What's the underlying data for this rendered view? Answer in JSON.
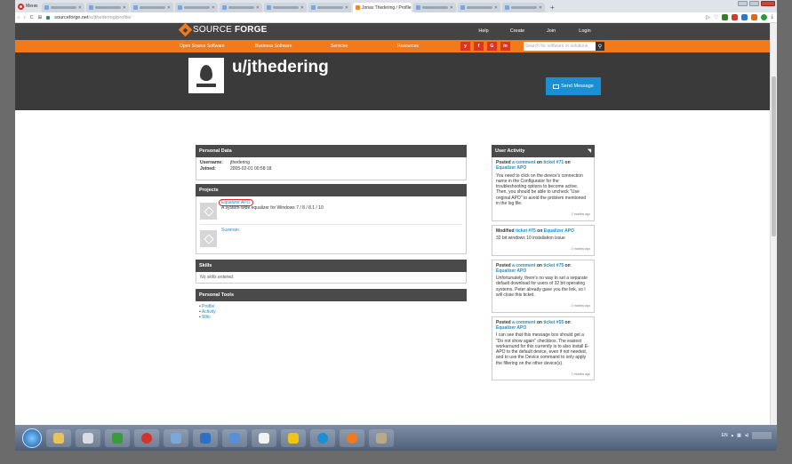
{
  "browser": {
    "opera_label": "Меню",
    "active_tab": "Jonas Thedering / Profile",
    "url_host": "sourceforge.net",
    "url_path": "/u/jthedering/profile/"
  },
  "site": {
    "logo_source": "SOURCE",
    "logo_forge": "FORGE",
    "top_nav": [
      "Help",
      "Create",
      "Join",
      "Login"
    ],
    "main_nav": [
      "Open Source Software",
      "Business Software",
      "Services",
      "Resources"
    ],
    "social": [
      "y",
      "f",
      "G",
      "in"
    ],
    "search_placeholder": "Search for software or solutions"
  },
  "profile": {
    "username": "u/jthedering",
    "send_message": "Send Message"
  },
  "personal_data": {
    "title": "Personal Data",
    "username_label": "Username:",
    "username_value": "jthedering",
    "joined_label": "Joined:",
    "joined_value": "2005-02-01 00:58:18"
  },
  "projects": {
    "title": "Projects",
    "items": [
      {
        "name": "Equalizer APO",
        "desc": "A system-wide equalizer for Windows 7 / 8 / 8.1 / 10"
      },
      {
        "name": "Suzerain",
        "desc": ""
      }
    ]
  },
  "skills": {
    "title": "Skills",
    "empty": "No skills entered."
  },
  "tools": {
    "title": "Personal Tools",
    "items": [
      "Profile",
      "Activity",
      "Wiki"
    ]
  },
  "activity": {
    "title": "User Activity",
    "entries": [
      {
        "pre": "Posted ",
        "link1": "a comment",
        "mid": " on ",
        "link2": "ticket #71",
        "on": " on ",
        "link3": "Equalizer APO",
        "body": "You need to click on the device's connection name in the Configurator for the troubleshooting options to become active. Then, you should be able to uncheck \"Use original APO\" to avoid the problem mentioned in the log file.",
        "ago": "2 months ago"
      },
      {
        "pre": "Modified ",
        "link1": "",
        "mid": "",
        "link2": "ticket #75",
        "on": " on ",
        "link3": "Equalizer APO",
        "body": "32 bit windows 10 installation issue",
        "ago": "2 months ago"
      },
      {
        "pre": "Posted ",
        "link1": "a comment",
        "mid": " on ",
        "link2": "ticket #75",
        "on": " on ",
        "link3": "Equalizer APO",
        "body": "Unfortunately, there's no way to set a separate default download for users of 32 bit operating systems. Peter already gave you the link, so I will close this ticket.",
        "ago": "2 months ago"
      },
      {
        "pre": "Posted ",
        "link1": "a comment",
        "mid": " on ",
        "link2": "ticket #55",
        "on": " on ",
        "link3": "Equalizer APO",
        "body": "I can see that this message box should get a \"Do not show again\" checkbox. The easiest workaround for this currently is to also install E-APO to the default device, even if not needed, and to use the Device command to only apply the filtering on the other device(s).",
        "ago": "2 months ago"
      }
    ]
  },
  "taskbar": {
    "tray_lang": "EN"
  }
}
